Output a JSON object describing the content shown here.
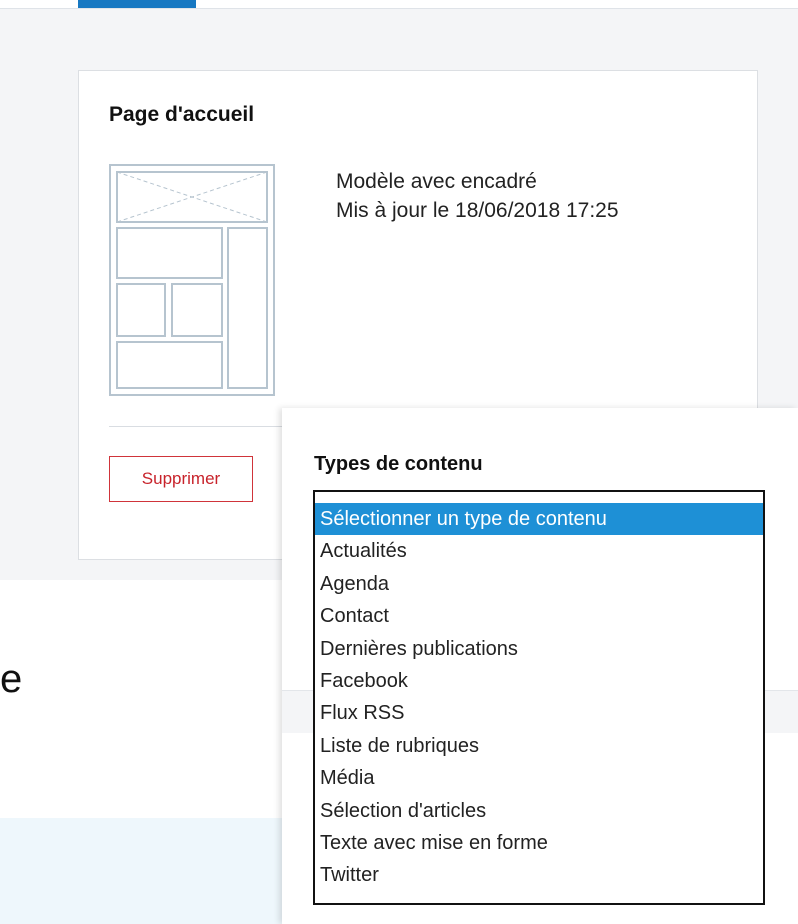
{
  "card": {
    "title": "Page d'accueil",
    "model": "Modèle avec encadré",
    "updated": "Mis à jour le 18/06/2018 17:25",
    "delete_label": "Supprimer"
  },
  "partial_text": "e",
  "panel": {
    "title": "Types de contenu",
    "options": [
      {
        "label": "Sélectionner un type de contenu",
        "selected": true
      },
      {
        "label": "Actualités"
      },
      {
        "label": "Agenda"
      },
      {
        "label": "Contact"
      },
      {
        "label": "Dernières publications"
      },
      {
        "label": "Facebook"
      },
      {
        "label": "Flux RSS"
      },
      {
        "label": "Liste de rubriques"
      },
      {
        "label": "Média"
      },
      {
        "label": "Sélection d'articles"
      },
      {
        "label": "Texte avec mise en forme"
      },
      {
        "label": "Twitter"
      }
    ]
  },
  "colors": {
    "accent": "#1778c2",
    "selected_option": "#1e90d6",
    "danger": "#c8232b"
  }
}
